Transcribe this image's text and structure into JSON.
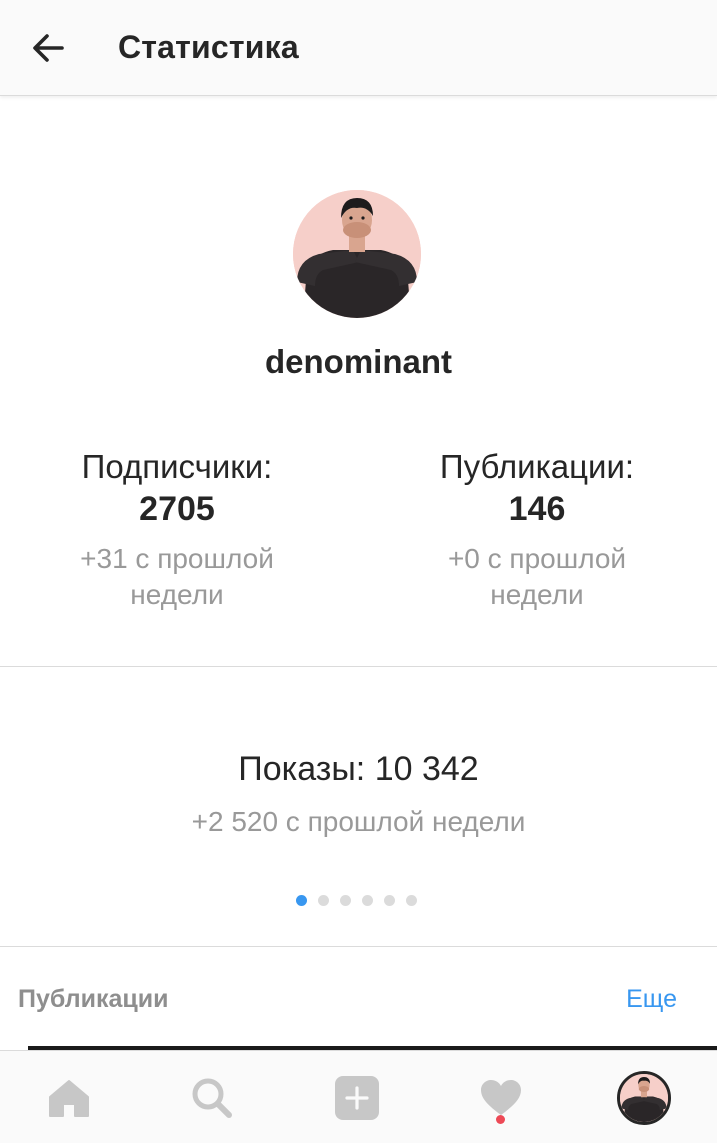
{
  "header": {
    "title": "Статистика",
    "back_icon": "arrow-left-icon"
  },
  "profile": {
    "username": "denominant",
    "avatar_icon": "avatar"
  },
  "stats": {
    "followers": {
      "label": "Подписчики:",
      "value": "2705",
      "change": "+31 с прошлой недели"
    },
    "posts": {
      "label": "Публикации:",
      "value": "146",
      "change": "+0 с прошлой недели"
    }
  },
  "impressions": {
    "label": "Показы: 10 342",
    "change": "+2 520 с прошлой недели"
  },
  "pager": {
    "total": 6,
    "active": 1
  },
  "posts_section": {
    "title": "Публикации",
    "more": "Еще"
  },
  "bottom_nav": {
    "items": [
      "home-icon",
      "search-icon",
      "add-icon",
      "heart-icon",
      "profile-avatar"
    ]
  },
  "colors": {
    "accent": "#3897f0",
    "notification": "#ed4956",
    "avatar_bg": "#f6cfc9"
  }
}
